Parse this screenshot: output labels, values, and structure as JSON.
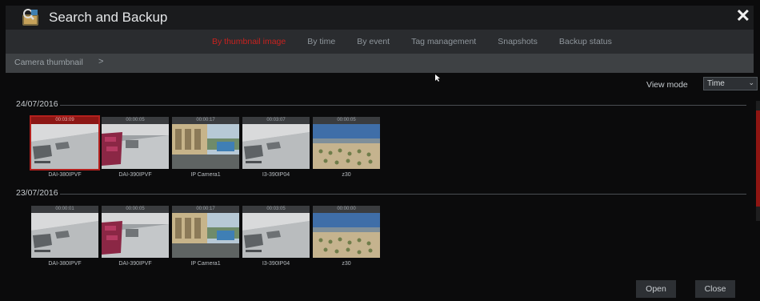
{
  "window": {
    "title": "Search and Backup",
    "close_icon": "close-icon"
  },
  "tabs": [
    {
      "label": "By thumbnail image",
      "active": true
    },
    {
      "label": "By time",
      "active": false
    },
    {
      "label": "By event",
      "active": false
    },
    {
      "label": "Tag management",
      "active": false
    },
    {
      "label": "Snapshots",
      "active": false
    },
    {
      "label": "Backup status",
      "active": false
    }
  ],
  "breadcrumb": {
    "label": "Camera thumbnail",
    "chevron": ">"
  },
  "view_mode": {
    "label": "View mode",
    "value": "Time"
  },
  "groups": [
    {
      "date": "24/07/2016",
      "items": [
        {
          "time": "00:03:09",
          "name": "DAI-380IPVF",
          "scene": "gray",
          "selected": true
        },
        {
          "time": "00:00:05",
          "name": "DAI-390IPVF",
          "scene": "magenta",
          "selected": false
        },
        {
          "time": "00:00:17",
          "name": "IP Camera1",
          "scene": "yard",
          "selected": false
        },
        {
          "time": "00:03:07",
          "name": "I3-390IP04",
          "scene": "gray",
          "selected": false
        },
        {
          "time": "00:00:05",
          "name": "z30",
          "scene": "aerial",
          "selected": false
        }
      ]
    },
    {
      "date": "23/07/2016",
      "items": [
        {
          "time": "00:00:01",
          "name": "DAI-380IPVF",
          "scene": "gray",
          "selected": false
        },
        {
          "time": "00:00:05",
          "name": "DAI-390IPVF",
          "scene": "magenta",
          "selected": false
        },
        {
          "time": "00:00:17",
          "name": "IP Camera1",
          "scene": "yard",
          "selected": false
        },
        {
          "time": "00:03:05",
          "name": "I3-390IP04",
          "scene": "gray",
          "selected": false
        },
        {
          "time": "00:00:00",
          "name": "z30",
          "scene": "aerial",
          "selected": false
        }
      ]
    }
  ],
  "buttons": {
    "open": "Open",
    "close": "Close"
  },
  "colors": {
    "accent": "#c8221f",
    "background": "#0b0b0c",
    "panel": "#2a2c2f"
  }
}
